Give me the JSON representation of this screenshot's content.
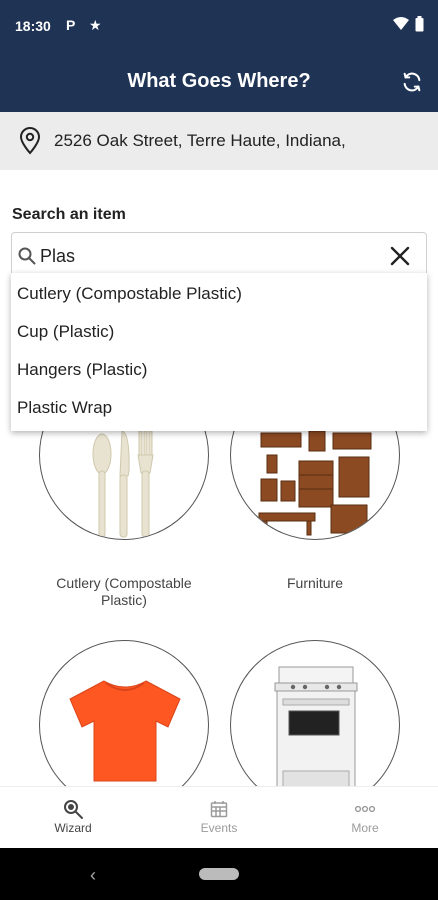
{
  "status_bar": {
    "time": "18:30",
    "notif1": "P",
    "notif2": "★"
  },
  "app_bar": {
    "title": "What Goes Where?"
  },
  "location": {
    "address": "2526 Oak Street, Terre Haute, Indiana,"
  },
  "search": {
    "label": "Search an item",
    "value": "Plas"
  },
  "suggestions": [
    "Cutlery (Compostable Plastic)",
    "Cup (Plastic)",
    "Hangers (Plastic)",
    "Plastic Wrap"
  ],
  "tiles": [
    {
      "label": "Cutlery (Compostable Plastic)"
    },
    {
      "label": "Furniture"
    },
    {
      "label": ""
    },
    {
      "label": ""
    }
  ],
  "bottom_nav": [
    {
      "label": "Wizard",
      "icon": "wizard-search-icon",
      "active": true
    },
    {
      "label": "Events",
      "icon": "calendar-icon",
      "active": false
    },
    {
      "label": "More",
      "icon": "more-dots-icon",
      "active": false
    }
  ],
  "colors": {
    "header": "#1f3355",
    "location_bg": "#ececec",
    "shirt": "#ff5722"
  }
}
